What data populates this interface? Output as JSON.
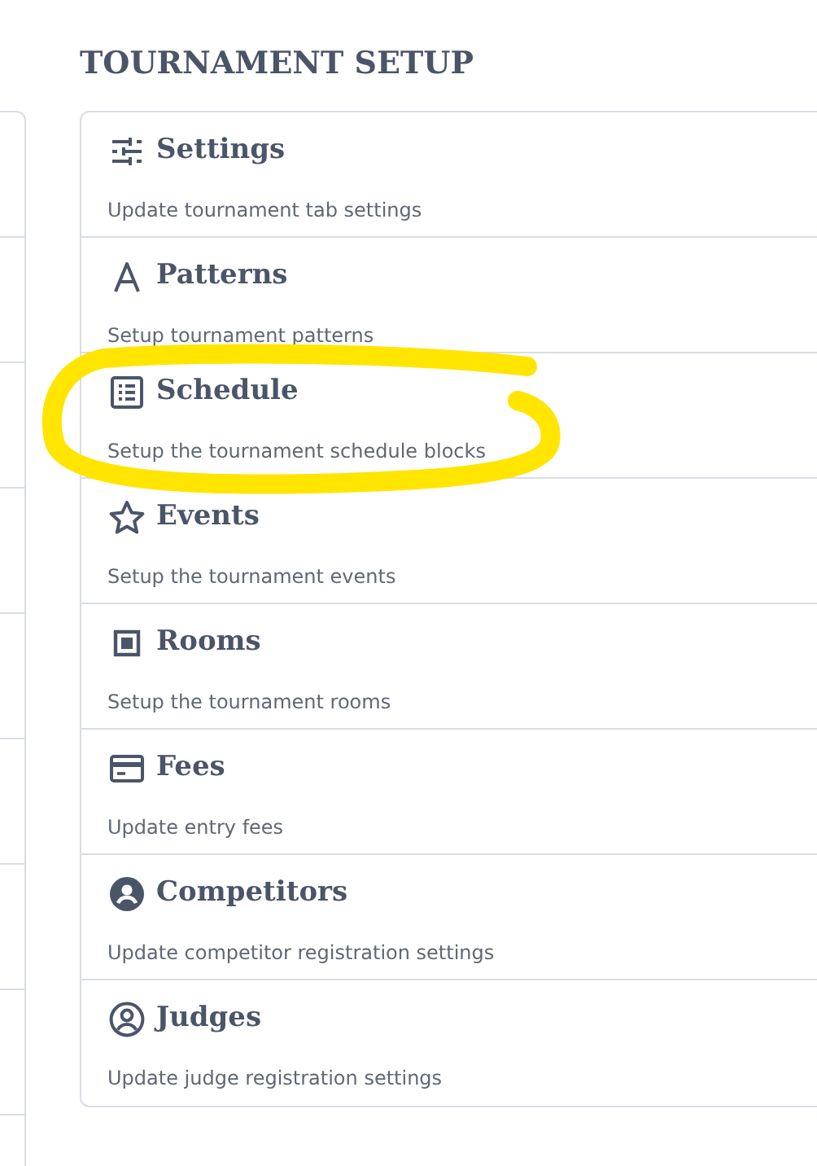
{
  "title": "TOURNAMENT SETUP",
  "items": [
    {
      "kind": "sliders",
      "label": "Settings",
      "description": "Update tournament tab settings",
      "highlighted": false
    },
    {
      "kind": "font",
      "label": "Patterns",
      "description": "Setup tournament patterns",
      "highlighted": false
    },
    {
      "kind": "list",
      "label": "Schedule",
      "description": "Setup the tournament schedule blocks",
      "highlighted": true
    },
    {
      "kind": "star",
      "label": "Events",
      "description": "Setup the tournament events",
      "highlighted": false
    },
    {
      "kind": "square",
      "label": "Rooms",
      "description": "Setup the tournament rooms",
      "highlighted": false
    },
    {
      "kind": "card",
      "label": "Fees",
      "description": "Update entry fees",
      "highlighted": false
    },
    {
      "kind": "person",
      "label": "Competitors",
      "description": "Update competitor registration settings",
      "highlighted": false
    },
    {
      "kind": "person-outline",
      "label": "Judges",
      "description": "Update judge registration settings",
      "highlighted": false
    }
  ]
}
